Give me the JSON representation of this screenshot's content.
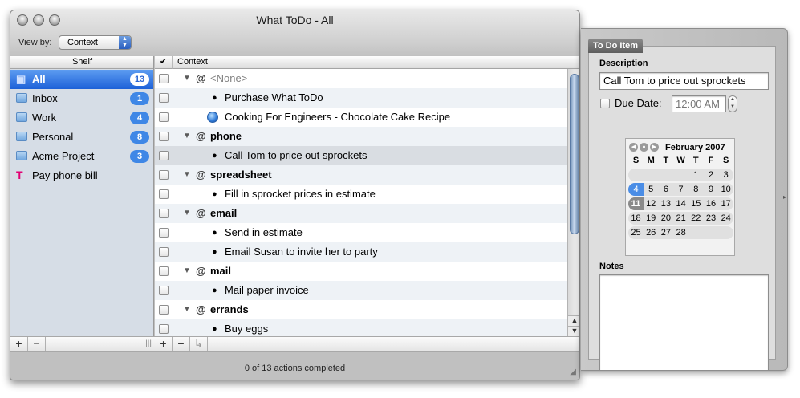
{
  "window": {
    "title": "What ToDo - All",
    "view_by_label": "View by:",
    "view_by_value": "Context",
    "status": "0 of 13  actions completed"
  },
  "shelf": {
    "header": "Shelf",
    "items": [
      {
        "label": "All",
        "count": "13",
        "icon": "computer-icon"
      },
      {
        "label": "Inbox",
        "count": "1",
        "icon": "folder-icon"
      },
      {
        "label": "Work",
        "count": "4",
        "icon": "folder-icon"
      },
      {
        "label": "Personal",
        "count": "8",
        "icon": "folder-icon"
      },
      {
        "label": "Acme Project",
        "count": "3",
        "icon": "folder-icon"
      },
      {
        "label": "Pay phone bill",
        "count": "",
        "icon": "t-mobile-icon"
      }
    ],
    "add_label": "+",
    "remove_label": "−"
  },
  "list": {
    "check_header": "✔",
    "context_header": "Context",
    "rows": [
      {
        "type": "context",
        "label": "<None>"
      },
      {
        "type": "action",
        "label": "Purchase What ToDo"
      },
      {
        "type": "action",
        "label": "Cooking For Engineers - Chocolate Cake Recipe"
      },
      {
        "type": "context",
        "label": "phone"
      },
      {
        "type": "action",
        "label": "Call Tom to price out sprockets"
      },
      {
        "type": "context",
        "label": "spreadsheet"
      },
      {
        "type": "action",
        "label": "Fill in sprocket prices in estimate"
      },
      {
        "type": "context",
        "label": "email"
      },
      {
        "type": "action",
        "label": "Send in estimate"
      },
      {
        "type": "action",
        "label": "Email Susan to invite her to party"
      },
      {
        "type": "context",
        "label": "mail"
      },
      {
        "type": "action",
        "label": "Mail paper invoice"
      },
      {
        "type": "context",
        "label": "errands"
      },
      {
        "type": "action",
        "label": "Buy eggs"
      }
    ],
    "at_symbol": "@",
    "add_label": "+",
    "remove_label": "−",
    "indent_label": "↳"
  },
  "drawer": {
    "tab": "To Do Item",
    "description_label": "Description",
    "description_value": "Call Tom to price out sprockets",
    "due_label": "Due Date:",
    "due_time": "12:00 AM",
    "notes_label": "Notes",
    "calendar": {
      "title": "February 2007",
      "weekdays": [
        "S",
        "M",
        "T",
        "W",
        "T",
        "F",
        "S"
      ],
      "weeks": [
        [
          "",
          "",
          "",
          "",
          "1",
          "2",
          "3"
        ],
        [
          "4",
          "5",
          "6",
          "7",
          "8",
          "9",
          "10"
        ],
        [
          "11",
          "12",
          "13",
          "14",
          "15",
          "16",
          "17"
        ],
        [
          "18",
          "19",
          "20",
          "21",
          "22",
          "23",
          "24"
        ],
        [
          "25",
          "26",
          "27",
          "28",
          "",
          "",
          ""
        ]
      ],
      "today": "4",
      "selected": "11"
    }
  },
  "colors": {
    "selection": "#1d61d8",
    "badge": "#3f87e6",
    "alt_row": "#eef2f6"
  }
}
